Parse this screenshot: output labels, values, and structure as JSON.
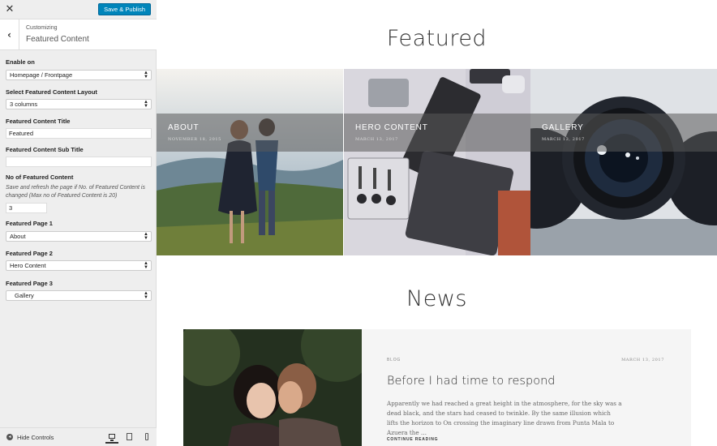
{
  "sidebar": {
    "close_icon": "close-icon",
    "save_label": "Save & Publish",
    "customizing_label": "Customizing",
    "section_title": "Featured Content",
    "controls": {
      "enable_on_label": "Enable on",
      "enable_on_value": "Homepage / Frontpage",
      "layout_label": "Select Featured Content Layout",
      "layout_value": "3 columns",
      "title_label": "Featured Content Title",
      "title_value": "Featured",
      "subtitle_label": "Featured Content Sub Title",
      "subtitle_value": "",
      "count_label": "No of Featured Content",
      "count_desc": "Save and refresh the page if No. of Featured Content is changed (Max no of Featured Content is 20)",
      "count_value": "3",
      "page1_label": "Featured Page 1",
      "page1_value": "About",
      "page2_label": "Featured Page 2",
      "page2_value": "Hero Content",
      "page3_label": "Featured Page 3",
      "page3_value": "Gallery"
    },
    "hide_controls_label": "Hide Controls",
    "devices": [
      "desktop-icon",
      "tablet-icon",
      "mobile-icon"
    ],
    "accent_color": "#0085ba"
  },
  "preview": {
    "featured_heading": "Featured",
    "featured_items": [
      {
        "title": "ABOUT",
        "date": "NOVEMBER 18, 2015"
      },
      {
        "title": "HERO CONTENT",
        "date": "MARCH 13, 2017"
      },
      {
        "title": "GALLERY",
        "date": "MARCH 13, 2017"
      }
    ],
    "news_heading": "News",
    "news_post": {
      "category": "BLOG",
      "date": "MARCH 13, 2017",
      "title": "Before I had time to respond",
      "excerpt": "Apparently we had reached a great height in the atmosphere, for the sky was a dead black, and the stars had ceased to twinkle. By the same illusion which lifts the horizon to On crossing the imaginary line drawn from Punta Mala to Azuera the …",
      "read_more": "CONTINUE READING"
    }
  }
}
